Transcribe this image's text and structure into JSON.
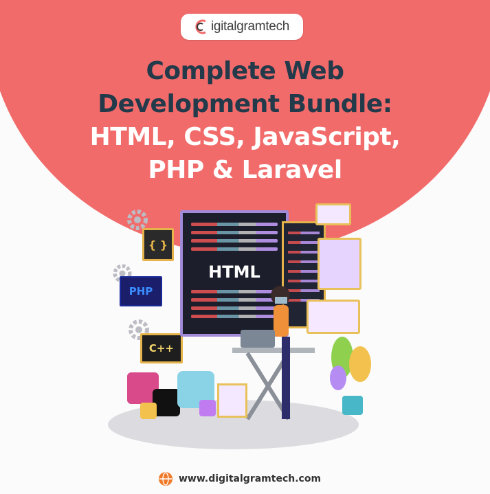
{
  "logo": {
    "text": "igitalgramtech",
    "icon": "d-swirl-logo"
  },
  "headline": {
    "line1": "Complete Web",
    "line2": "Development Bundle:",
    "line3": "HTML, CSS, JavaScript,",
    "line4": "PHP & Laravel"
  },
  "tags": {
    "braces": "{ }",
    "php": "PHP",
    "cpp": "C++",
    "html": "HTML"
  },
  "footer": {
    "url": "www.digitalgramtech.com",
    "icon": "globe-icon"
  },
  "colors": {
    "accent_circle": "#f26b6b",
    "headline_dark": "#223a4a",
    "headline_light": "#ffffff",
    "monitor_frame": "#a18ad8",
    "tag_yellow": "#e5b34a",
    "footer_icon": "#f07a2a"
  }
}
